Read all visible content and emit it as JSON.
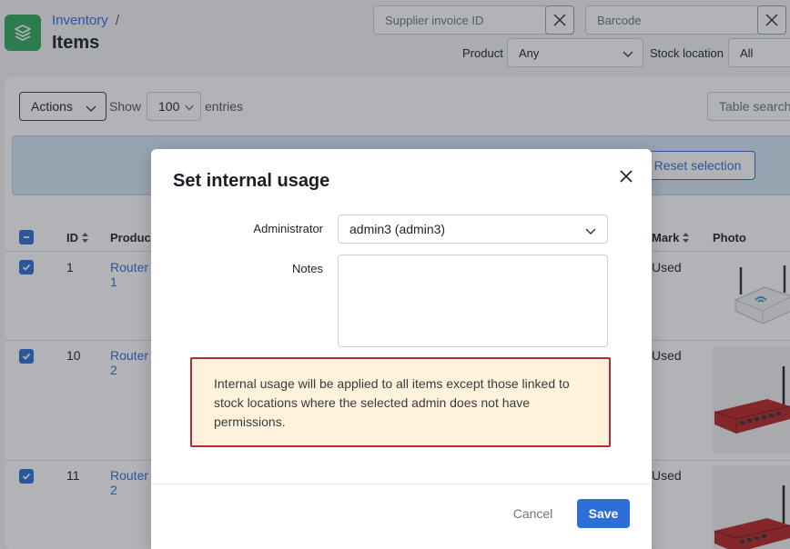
{
  "header": {
    "breadcrumb_parent": "Inventory",
    "breadcrumb_separator": "/",
    "title": "Items"
  },
  "filters": {
    "supplier_invoice_placeholder": "Supplier invoice ID",
    "barcode_placeholder": "Barcode",
    "product_label": "Product",
    "product_value": "Any",
    "stock_location_label": "Stock location",
    "stock_location_value": "All"
  },
  "toolbar": {
    "actions_label": "Actions",
    "show_label": "Show",
    "entries_value": "100",
    "entries_label": "entries",
    "table_search_placeholder": "Table search"
  },
  "selection_bar": {
    "reset_label": "Reset selection"
  },
  "table": {
    "columns": [
      "ID",
      "Product",
      "Mark",
      "Photo"
    ],
    "rows": [
      {
        "id": "1",
        "product_line1": "Router",
        "product_line2": "1",
        "mark": "Used",
        "photo": "router-white"
      },
      {
        "id": "10",
        "product_line1": "Router",
        "product_line2": "2",
        "mark": "Used",
        "photo": "router-red"
      },
      {
        "id": "11",
        "product_line1": "Router",
        "product_line2": "2",
        "mark": "Used",
        "photo": "router-red"
      }
    ]
  },
  "modal": {
    "title": "Set internal usage",
    "administrator_label": "Administrator",
    "administrator_value": "admin3 (admin3)",
    "notes_label": "Notes",
    "notes_value": "",
    "warning": "Internal usage will be applied to all items except those linked to stock locations where the selected admin does not have permissions.",
    "cancel_label": "Cancel",
    "save_label": "Save"
  },
  "colors": {
    "accent": "#2d6fd6",
    "logo": "#2fa95b",
    "warning_border": "#b22c38",
    "warning_bg": "#fff2dc"
  }
}
